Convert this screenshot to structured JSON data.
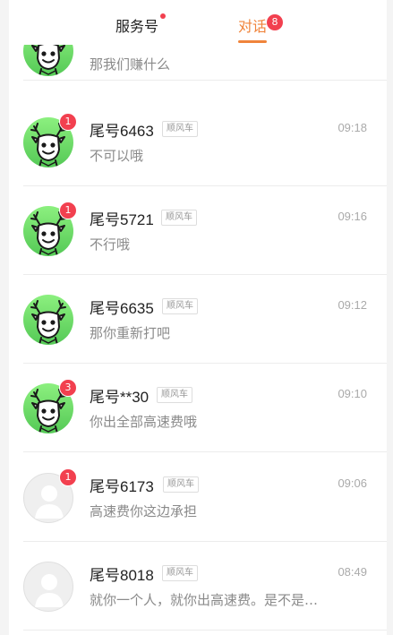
{
  "tabs": {
    "service_label": "服务号",
    "chat_label": "对话",
    "chat_count": "8"
  },
  "conversations": [
    {
      "name": "",
      "tag": "",
      "time": "",
      "message": "那我们赚什么",
      "badge": "",
      "avatar": "deer"
    },
    {
      "name": "尾号6463",
      "tag": "顺风车",
      "time": "09:18",
      "message": "不可以哦",
      "badge": "1",
      "avatar": "deer"
    },
    {
      "name": "尾号5721",
      "tag": "顺风车",
      "time": "09:16",
      "message": "不行哦",
      "badge": "1",
      "avatar": "deer"
    },
    {
      "name": "尾号6635",
      "tag": "顺风车",
      "time": "09:12",
      "message": "那你重新打吧",
      "badge": "",
      "avatar": "deer"
    },
    {
      "name": "尾号**30",
      "tag": "顺风车",
      "time": "09:10",
      "message": "你出全部高速费哦",
      "badge": "3",
      "avatar": "deer"
    },
    {
      "name": "尾号6173",
      "tag": "顺风车",
      "time": "09:06",
      "message": "高速费你这边承担",
      "badge": "1",
      "avatar": "blank"
    },
    {
      "name": "尾号8018",
      "tag": "顺风车",
      "time": "08:49",
      "message": "就你一个人，就你出高速费。是不是…",
      "badge": "",
      "avatar": "blank"
    }
  ],
  "colors": {
    "accent": "#f0843b",
    "badge": "#f2404f",
    "avatar_green": "#6ad86a"
  },
  "icons": {
    "deer_avatar": "deer-avatar-icon",
    "default_avatar": "person-silhouette-icon"
  }
}
